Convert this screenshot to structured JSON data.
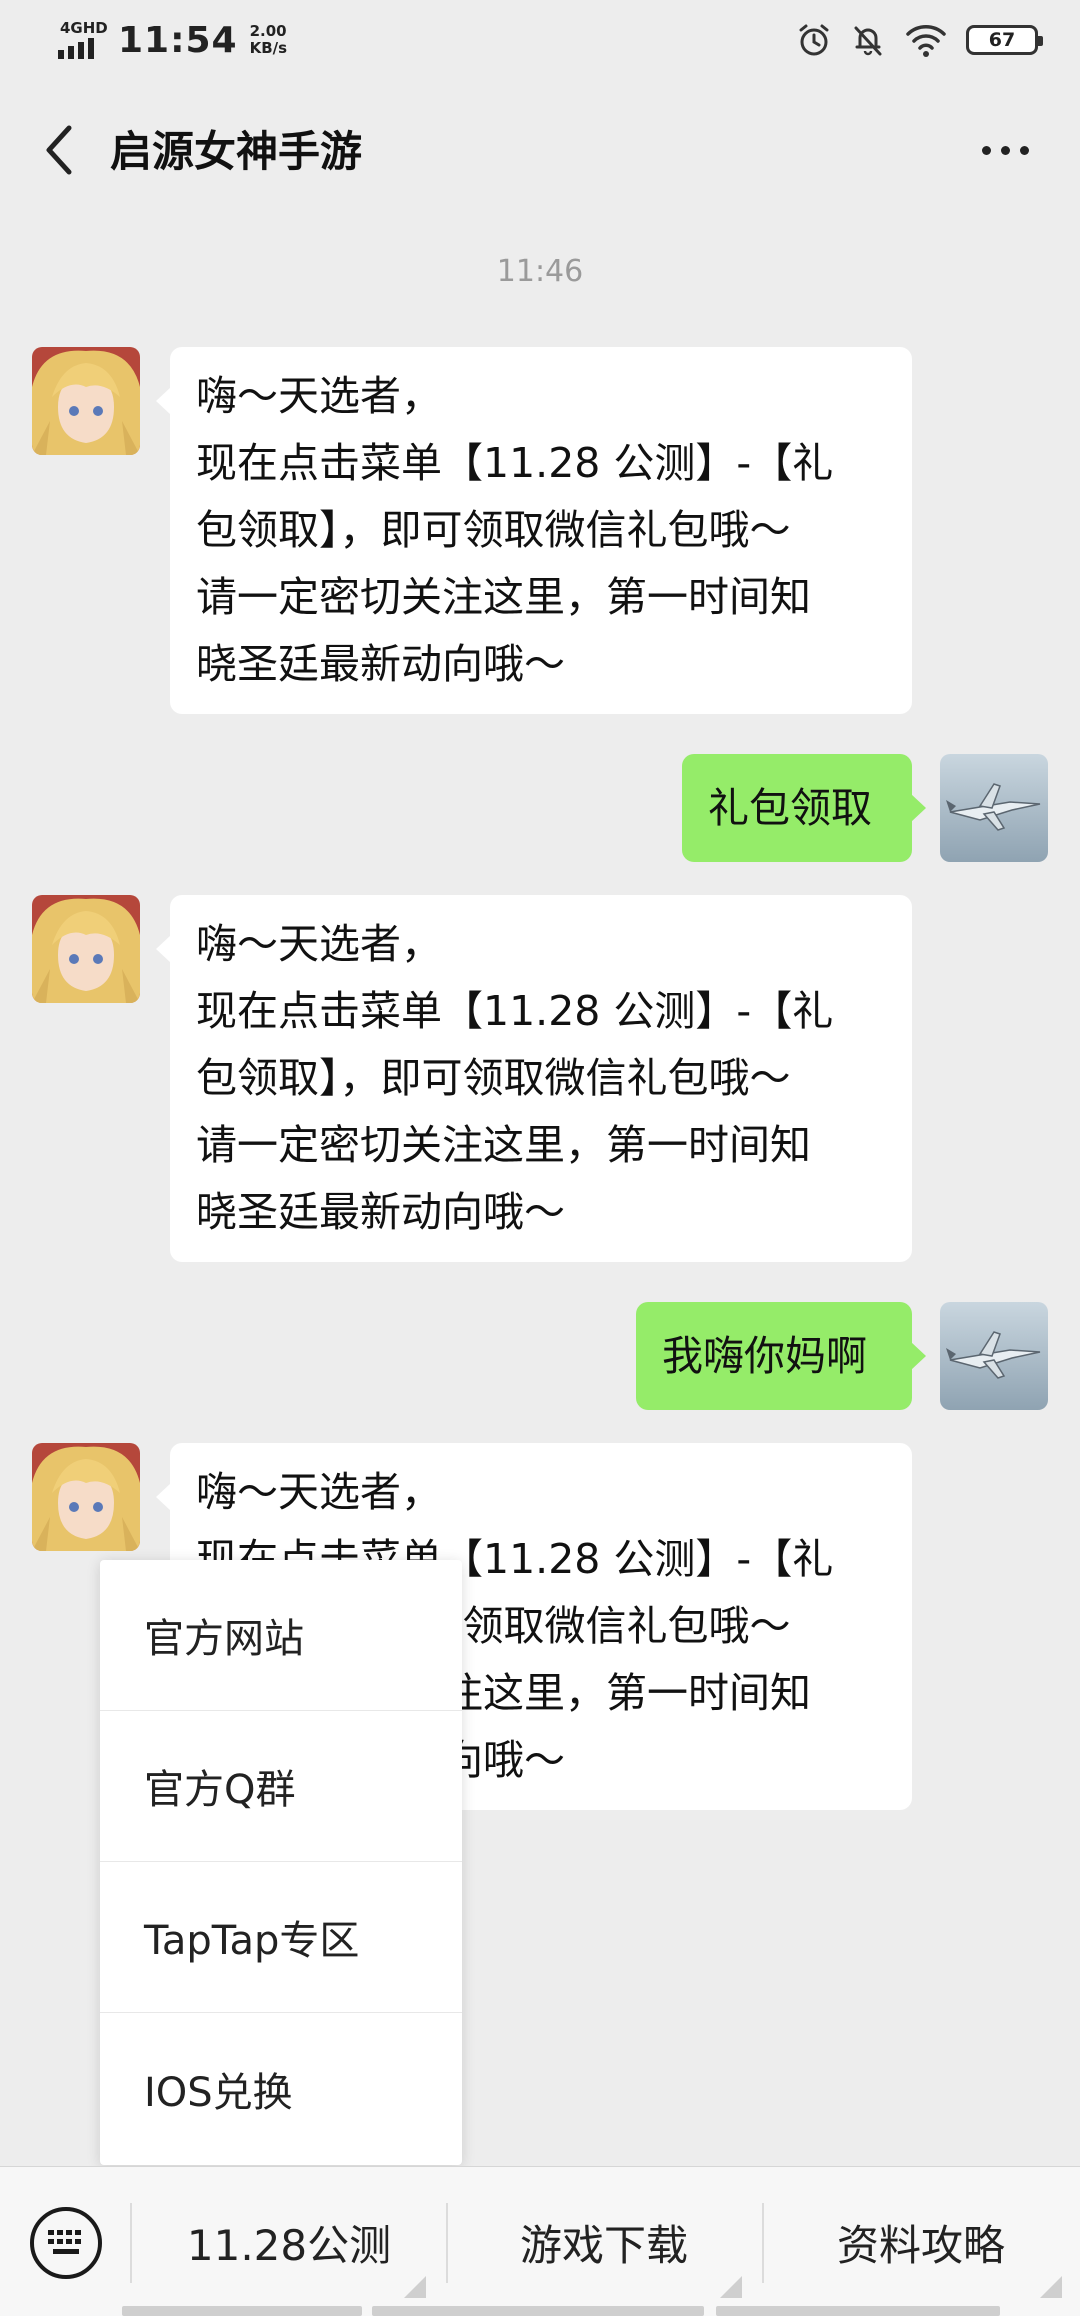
{
  "status_bar": {
    "network": "4GHD",
    "time": "11:54",
    "speed_value": "2.00",
    "speed_unit": "KB/s",
    "battery": "67",
    "icons": [
      "alarm-icon",
      "mute-bell-icon",
      "wifi-icon",
      "battery-icon"
    ]
  },
  "header": {
    "title": "启源女神手游",
    "back_icon": "chevron-left-icon",
    "more_icon": "more-dots-icon"
  },
  "chat": {
    "timestamp": "11:46",
    "messages": [
      {
        "sender": "official",
        "lines": [
          "嗨～天选者，",
          "现在点击菜单【11.28 公测】-【礼",
          "包领取】，即可领取微信礼包哦～",
          "请一定密切关注这里，第一时间知",
          "晓圣廷最新动向哦～"
        ]
      },
      {
        "sender": "me",
        "text": "礼包领取"
      },
      {
        "sender": "official",
        "lines": [
          "嗨～天选者，",
          "现在点击菜单【11.28 公测】-【礼",
          "包领取】，即可领取微信礼包哦～",
          "请一定密切关注这里，第一时间知",
          "晓圣廷最新动向哦～"
        ]
      },
      {
        "sender": "me",
        "text": "我嗨你妈啊"
      },
      {
        "sender": "official",
        "lines": [
          "嗨～天选者，",
          "现在点击菜单【11.28 公测】-【礼",
          "包领取】，即可领取微信礼包哦～",
          "请一定密切关注这里，第一时间知",
          "晓圣廷最新动向哦～"
        ]
      }
    ]
  },
  "popup_menu": {
    "items": [
      "官方网站",
      "官方Q群",
      "TapTap专区",
      "IOS兑换"
    ]
  },
  "bottom_menu": {
    "keyboard_icon": "keyboard-icon",
    "tabs": [
      "11.28公测",
      "游戏下载",
      "资料攻略"
    ]
  },
  "colors": {
    "background": "#ededed",
    "outgoing_bubble": "#95ec69",
    "incoming_bubble": "#ffffff"
  }
}
